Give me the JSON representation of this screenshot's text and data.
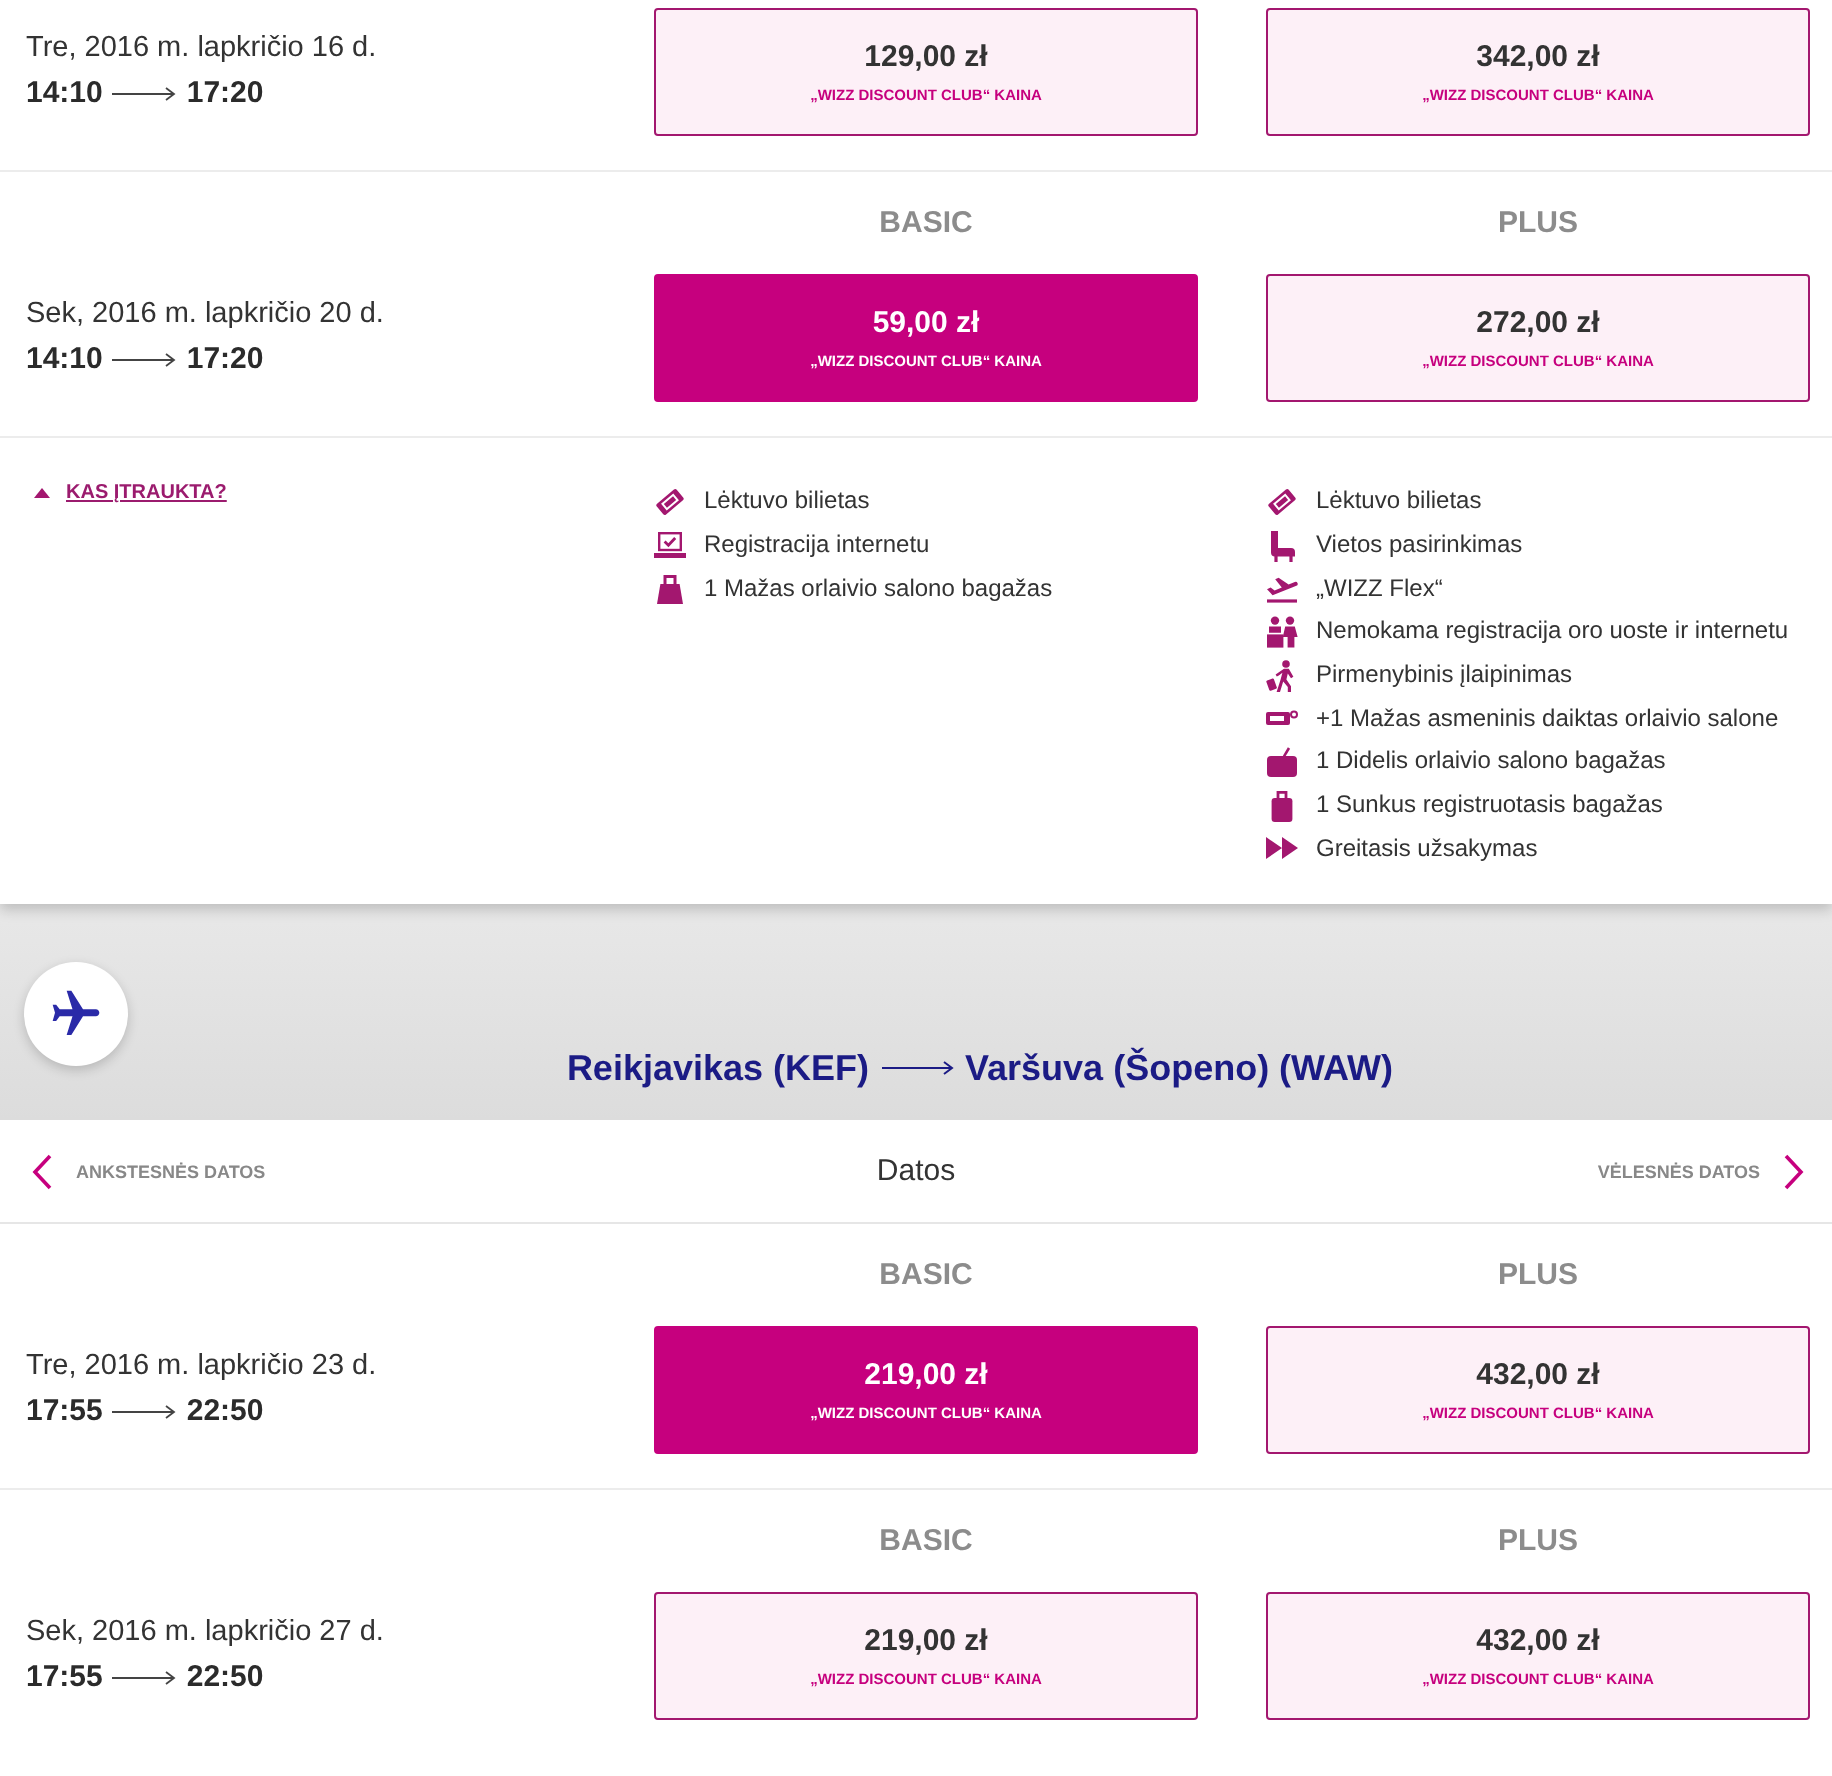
{
  "outbound": {
    "flights": [
      {
        "date": "Tre, 2016 m. lapkričio 16 d.",
        "departure": "14:10",
        "arrival": "17:20",
        "fares": [
          {
            "price": "129,00 zł",
            "label": "„WIZZ DISCOUNT CLUB“ KAINA",
            "selected": false
          },
          {
            "price": "342,00 zł",
            "label": "„WIZZ DISCOUNT CLUB“ KAINA",
            "selected": false
          }
        ]
      },
      {
        "date": "Sek, 2016 m. lapkričio 20 d.",
        "departure": "14:10",
        "arrival": "17:20",
        "fares": [
          {
            "name": "BASIC",
            "price": "59,00 zł",
            "label": "„WIZZ DISCOUNT CLUB“ KAINA",
            "selected": true
          },
          {
            "name": "PLUS",
            "price": "272,00 zł",
            "label": "„WIZZ DISCOUNT CLUB“ KAINA",
            "selected": false
          }
        ]
      }
    ],
    "included": {
      "toggle": {
        "label": "KAS ĮTRAUKTA?",
        "expanded": true
      },
      "bundles": [
        {
          "items": [
            {
              "kind": "ticket",
              "text": "Lėktuvo bilietas"
            },
            {
              "kind": "online-checkin",
              "text": "Registracija internetu"
            },
            {
              "kind": "small-bag",
              "text": "1 Mažas orlaivio salono bagažas"
            }
          ]
        },
        {
          "items": [
            {
              "kind": "ticket",
              "text": "Lėktuvo bilietas"
            },
            {
              "kind": "seat",
              "text": "Vietos pasirinkimas"
            },
            {
              "kind": "flex",
              "text": "„WIZZ Flex“"
            },
            {
              "kind": "airport-checkin",
              "text": "Nemokama registracija oro uoste ir internetu"
            },
            {
              "kind": "priority",
              "text": "Pirmenybinis įlaipinimas"
            },
            {
              "kind": "personal-item",
              "text": "+1 Mažas asmeninis daiktas orlaivio salone"
            },
            {
              "kind": "cabin-bag",
              "text": "1 Didelis orlaivio salono bagažas"
            },
            {
              "kind": "checked-bag",
              "text": "1 Sunkus registruotasis bagažas"
            },
            {
              "kind": "fast",
              "text": "Greitasis užsakymas"
            }
          ]
        }
      ]
    }
  },
  "inbound": {
    "route": {
      "origin": "Reikjavikas (KEF)",
      "destination": "Varšuva (Šopeno) (WAW)"
    },
    "date_nav": {
      "previous": "ANKSTESNĖS DATOS",
      "current": "Datos",
      "next": "VĖLESNĖS DATOS"
    },
    "flights": [
      {
        "date": "Tre, 2016 m. lapkričio 23 d.",
        "departure": "17:55",
        "arrival": "22:50",
        "fares": [
          {
            "name": "BASIC",
            "price": "219,00 zł",
            "label": "„WIZZ DISCOUNT CLUB“ KAINA",
            "selected": true
          },
          {
            "name": "PLUS",
            "price": "432,00 zł",
            "label": "„WIZZ DISCOUNT CLUB“ KAINA",
            "selected": false
          }
        ]
      },
      {
        "date": "Sek, 2016 m. lapkričio 27 d.",
        "departure": "17:55",
        "arrival": "22:50",
        "fares": [
          {
            "name": "BASIC",
            "price": "219,00 zł",
            "label": "„WIZZ DISCOUNT CLUB“ KAINA",
            "selected": false
          },
          {
            "name": "PLUS",
            "price": "432,00 zł",
            "label": "„WIZZ DISCOUNT CLUB“ KAINA",
            "selected": false
          }
        ]
      }
    ]
  }
}
